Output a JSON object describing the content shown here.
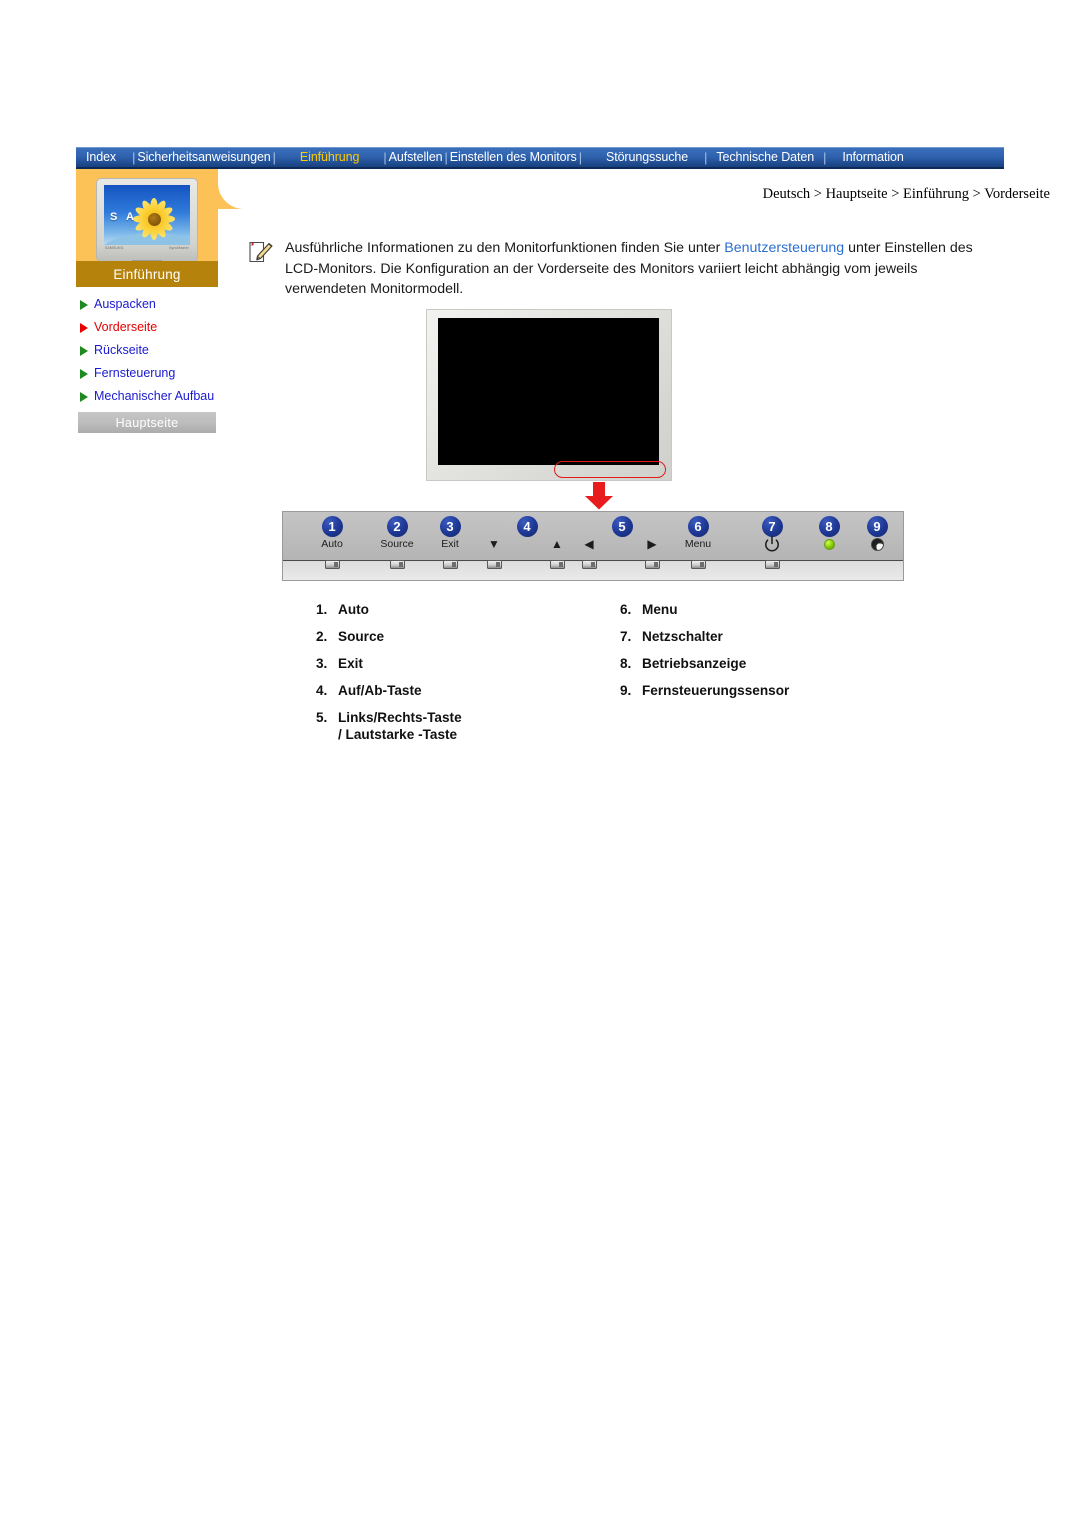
{
  "navbar": {
    "items": [
      {
        "label": "Index",
        "active": false
      },
      {
        "label": "Sicherheitsanweisungen",
        "active": false
      },
      {
        "label": "Einführung",
        "active": true
      },
      {
        "label": "Aufstellen",
        "active": false
      },
      {
        "label": "Einstellen des Monitors",
        "active": false
      },
      {
        "label": "Störungssuche",
        "active": false
      },
      {
        "label": "Technische Daten",
        "active": false
      },
      {
        "label": "Information",
        "active": false
      }
    ],
    "separator": "|"
  },
  "sidebar": {
    "panel_label": "Einführung",
    "thumbnail": {
      "screen_text": "S A M",
      "brand_left": "SAMSUNG",
      "brand_right": "SyncMaster"
    },
    "items": [
      {
        "label": "Auspacken",
        "state": "normal"
      },
      {
        "label": "Vorderseite",
        "state": "current"
      },
      {
        "label": "Rückseite",
        "state": "normal"
      },
      {
        "label": "Fernsteuerung",
        "state": "normal"
      },
      {
        "label": "Mechanischer Aufbau",
        "state": "normal"
      }
    ],
    "home_button": "Hauptseite"
  },
  "breadcrumb": "Deutsch > Hauptseite > Einführung > Vorderseite",
  "note": {
    "text_before": "Ausführliche Informationen zu den Monitorfunktionen finden Sie unter ",
    "link": "Benutzersteuerung",
    "text_after": " unter Einstellen des LCD-Monitors. Die Konfiguration an der Vorderseite des Monitors variiert leicht abhängig vom jeweils verwendeten Monitormodell."
  },
  "control_panel": {
    "buttons": [
      {
        "badge": "1",
        "label": "Auto",
        "glyph": "",
        "kind": "text"
      },
      {
        "badge": "2",
        "label": "Source",
        "glyph": "",
        "kind": "text"
      },
      {
        "badge": "3",
        "label": "Exit",
        "glyph": "",
        "kind": "text"
      },
      {
        "badge": "4",
        "label": "",
        "glyph": "▼",
        "kind": "glyph"
      },
      {
        "badge": "",
        "label": "",
        "glyph": "▲",
        "kind": "glyph"
      },
      {
        "badge": "5",
        "label": "",
        "glyph": "◀",
        "kind": "glyph"
      },
      {
        "badge": "",
        "label": "",
        "glyph": "▶",
        "kind": "glyph"
      },
      {
        "badge": "6",
        "label": "Menu",
        "glyph": "",
        "kind": "text"
      },
      {
        "badge": "7",
        "label": "",
        "glyph": "",
        "kind": "power"
      },
      {
        "badge": "8",
        "label": "",
        "glyph": "",
        "kind": "led"
      },
      {
        "badge": "9",
        "label": "",
        "glyph": "",
        "kind": "sensor"
      }
    ]
  },
  "legend": {
    "left": [
      {
        "num": "1.",
        "text": "Auto",
        "sub": ""
      },
      {
        "num": "2.",
        "text": "Source",
        "sub": ""
      },
      {
        "num": "3.",
        "text": "Exit",
        "sub": ""
      },
      {
        "num": "4.",
        "text": "Auf/Ab-Taste",
        "sub": ""
      },
      {
        "num": "5.",
        "text": "Links/Rechts-Taste",
        "sub": "/ Lautstarke -Taste"
      }
    ],
    "right": [
      {
        "num": "6.",
        "text": "Menu",
        "sub": ""
      },
      {
        "num": "7.",
        "text": "Netzschalter",
        "sub": ""
      },
      {
        "num": "8.",
        "text": "Betriebsanzeige",
        "sub": ""
      },
      {
        "num": "9.",
        "text": "Fernsteuerungssensor",
        "sub": ""
      }
    ]
  },
  "colors": {
    "nav_blue": "#2f62ae",
    "nav_active": "#ffcc00",
    "sidebar_orange": "#fcc257",
    "sidebar_label_bar": "#b5830c",
    "link_blue": "#1a1ad0",
    "current_red": "#e60000",
    "badge_blue": "#1d3793",
    "highlight_red": "#e11b1b",
    "led_green": "#8fd407"
  }
}
